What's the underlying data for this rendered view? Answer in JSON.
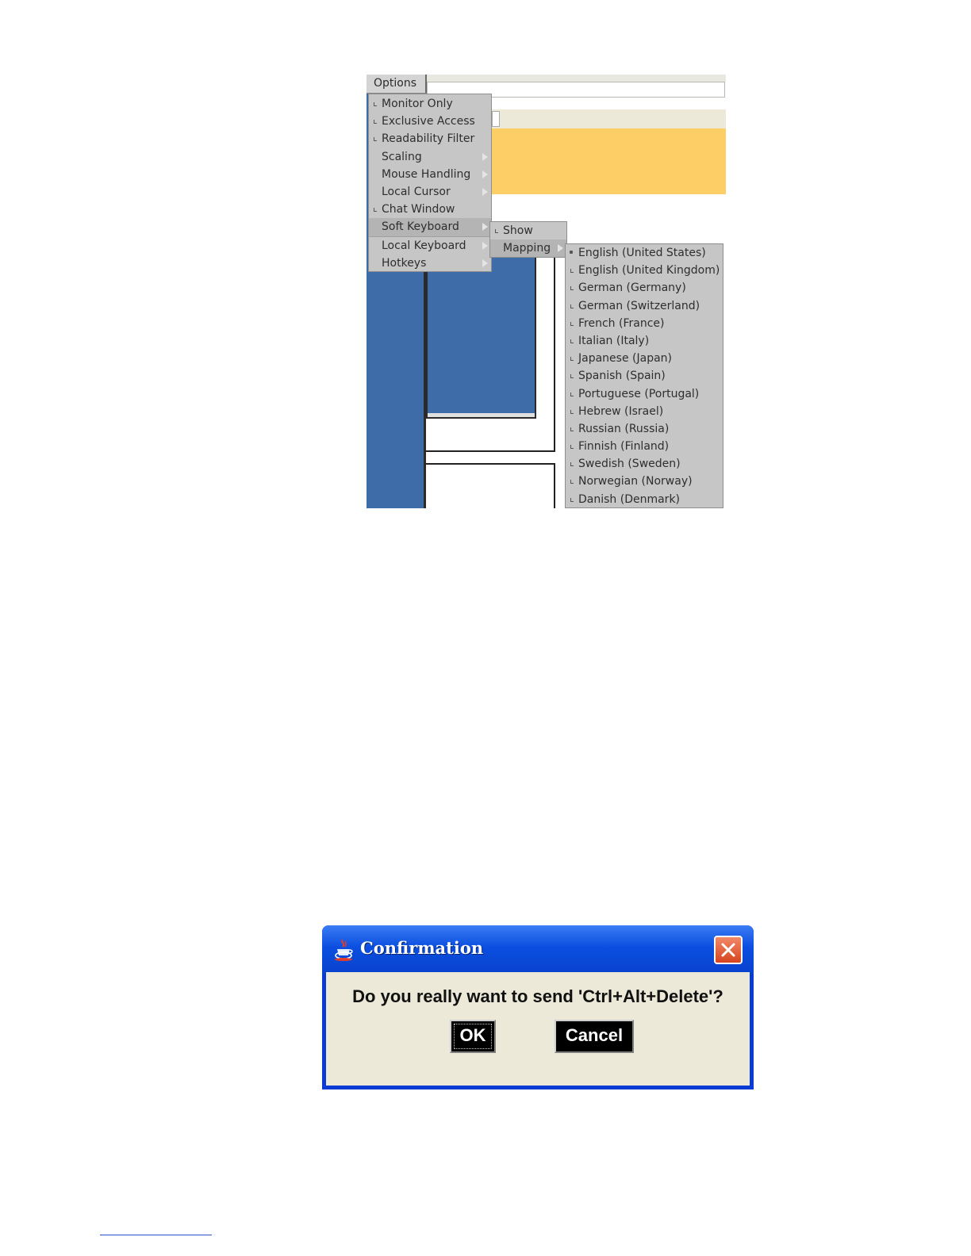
{
  "options_menu": {
    "label": "Options",
    "items": [
      {
        "label": "Monitor Only",
        "check": true,
        "submenu": false
      },
      {
        "label": "Exclusive Access",
        "check": true,
        "submenu": false
      },
      {
        "label": "Readability Filter",
        "check": true,
        "submenu": false
      },
      {
        "label": "Scaling",
        "check": false,
        "submenu": true
      },
      {
        "label": "Mouse Handling",
        "check": false,
        "submenu": true
      },
      {
        "label": "Local Cursor",
        "check": false,
        "submenu": true
      },
      {
        "label": "Chat Window",
        "check": true,
        "submenu": false
      },
      {
        "label": "Soft Keyboard",
        "check": false,
        "submenu": true,
        "selected": true
      },
      {
        "label": "Local Keyboard",
        "check": false,
        "submenu": true
      },
      {
        "label": "Hotkeys",
        "check": false,
        "submenu": true
      }
    ]
  },
  "soft_keyboard_menu": {
    "items": [
      {
        "label": "Show",
        "check": true,
        "submenu": false
      },
      {
        "label": "Mapping",
        "check": false,
        "submenu": true,
        "selected": true
      }
    ]
  },
  "mapping_menu": {
    "selected": "English (United States)",
    "items": [
      "English (United States)",
      "English (United Kingdom)",
      "German (Germany)",
      "German (Switzerland)",
      "French (France)",
      "Italian (Italy)",
      "Japanese (Japan)",
      "Spanish (Spain)",
      "Portuguese (Portugal)",
      "Hebrew (Israel)",
      "Russian (Russia)",
      "Finnish (Finland)",
      "Swedish (Sweden)",
      "Norwegian (Norway)",
      "Danish (Denmark)"
    ]
  },
  "confirmation_dialog": {
    "title": "Confirmation",
    "message": "Do you really want to send 'Ctrl+Alt+Delete'?",
    "ok_label": "OK",
    "cancel_label": "Cancel",
    "icons": {
      "title": "java-cup-icon",
      "close": "close-icon"
    },
    "colors": {
      "titlebar": "#0b4ee0",
      "close": "#d6451f",
      "body": "#ece9d8"
    }
  }
}
